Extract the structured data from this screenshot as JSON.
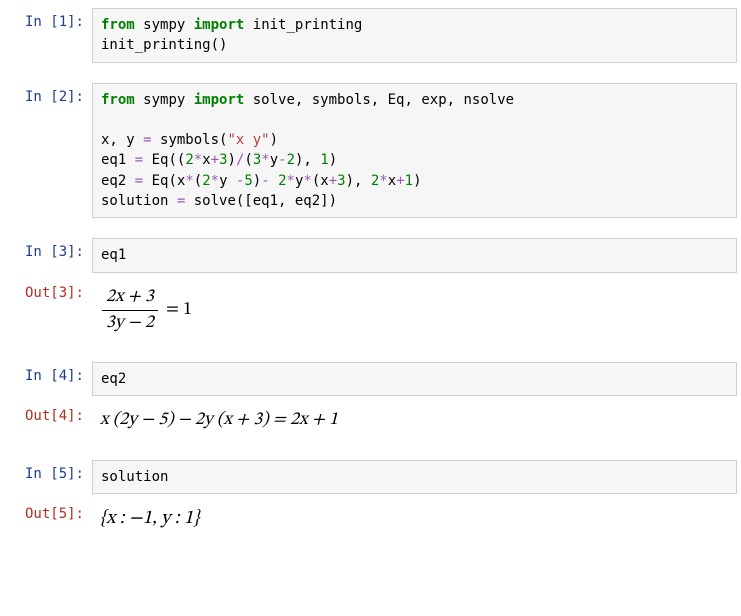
{
  "cells": {
    "c1": {
      "in_label": "In [1]:",
      "code_tokens": [
        {
          "t": "from",
          "c": "k"
        },
        {
          "t": " "
        },
        {
          "t": "sympy",
          "c": "nn"
        },
        {
          "t": " "
        },
        {
          "t": "import",
          "c": "kn"
        },
        {
          "t": " "
        },
        {
          "t": "init_printing",
          "c": "fn"
        },
        {
          "t": "\n"
        },
        {
          "t": "init_printing()"
        }
      ]
    },
    "c2": {
      "in_label": "In [2]:",
      "code_tokens": [
        {
          "t": "from",
          "c": "k"
        },
        {
          "t": " "
        },
        {
          "t": "sympy",
          "c": "nn"
        },
        {
          "t": " "
        },
        {
          "t": "import",
          "c": "kn"
        },
        {
          "t": " solve, symbols, Eq, exp, nsolve"
        },
        {
          "t": "\n"
        },
        {
          "t": "\n"
        },
        {
          "t": "x, y "
        },
        {
          "t": "=",
          "c": "op"
        },
        {
          "t": " symbols("
        },
        {
          "t": "\"x y\"",
          "c": "str"
        },
        {
          "t": ")"
        },
        {
          "t": "\n"
        },
        {
          "t": "eq1 "
        },
        {
          "t": "=",
          "c": "op"
        },
        {
          "t": " Eq(("
        },
        {
          "t": "2",
          "c": "num"
        },
        {
          "t": "*",
          "c": "op"
        },
        {
          "t": "x"
        },
        {
          "t": "+",
          "c": "op"
        },
        {
          "t": "3",
          "c": "num"
        },
        {
          "t": ")"
        },
        {
          "t": "/",
          "c": "op"
        },
        {
          "t": "("
        },
        {
          "t": "3",
          "c": "num"
        },
        {
          "t": "*",
          "c": "op"
        },
        {
          "t": "y"
        },
        {
          "t": "-",
          "c": "op"
        },
        {
          "t": "2",
          "c": "num"
        },
        {
          "t": "), "
        },
        {
          "t": "1",
          "c": "num"
        },
        {
          "t": ")"
        },
        {
          "t": "\n"
        },
        {
          "t": "eq2 "
        },
        {
          "t": "=",
          "c": "op"
        },
        {
          "t": " Eq(x"
        },
        {
          "t": "*",
          "c": "op"
        },
        {
          "t": "("
        },
        {
          "t": "2",
          "c": "num"
        },
        {
          "t": "*",
          "c": "op"
        },
        {
          "t": "y "
        },
        {
          "t": "-",
          "c": "op"
        },
        {
          "t": "5",
          "c": "num"
        },
        {
          "t": ")"
        },
        {
          "t": "-",
          "c": "op"
        },
        {
          "t": " "
        },
        {
          "t": "2",
          "c": "num"
        },
        {
          "t": "*",
          "c": "op"
        },
        {
          "t": "y"
        },
        {
          "t": "*",
          "c": "op"
        },
        {
          "t": "(x"
        },
        {
          "t": "+",
          "c": "op"
        },
        {
          "t": "3",
          "c": "num"
        },
        {
          "t": "), "
        },
        {
          "t": "2",
          "c": "num"
        },
        {
          "t": "*",
          "c": "op"
        },
        {
          "t": "x"
        },
        {
          "t": "+",
          "c": "op"
        },
        {
          "t": "1",
          "c": "num"
        },
        {
          "t": ")"
        },
        {
          "t": "\n"
        },
        {
          "t": "solution "
        },
        {
          "t": "=",
          "c": "op"
        },
        {
          "t": " solve([eq1, eq2])"
        }
      ]
    },
    "c3": {
      "in_label": "In [3]:",
      "code_tokens": [
        {
          "t": "eq1"
        }
      ],
      "out_label": "Out[3]:",
      "output": {
        "type": "fraction_eq",
        "numerator": "2x + 3",
        "denominator": "3y − 2",
        "rhs": "= 1"
      }
    },
    "c4": {
      "in_label": "In [4]:",
      "code_tokens": [
        {
          "t": "eq2"
        }
      ],
      "out_label": "Out[4]:",
      "output": {
        "type": "plain",
        "text": "x (2y − 5) − 2y (x + 3) = 2x + 1"
      }
    },
    "c5": {
      "in_label": "In [5]:",
      "code_tokens": [
        {
          "t": "solution"
        }
      ],
      "out_label": "Out[5]:",
      "output": {
        "type": "plain",
        "text": "{x : −1,  y : 1}"
      }
    }
  }
}
